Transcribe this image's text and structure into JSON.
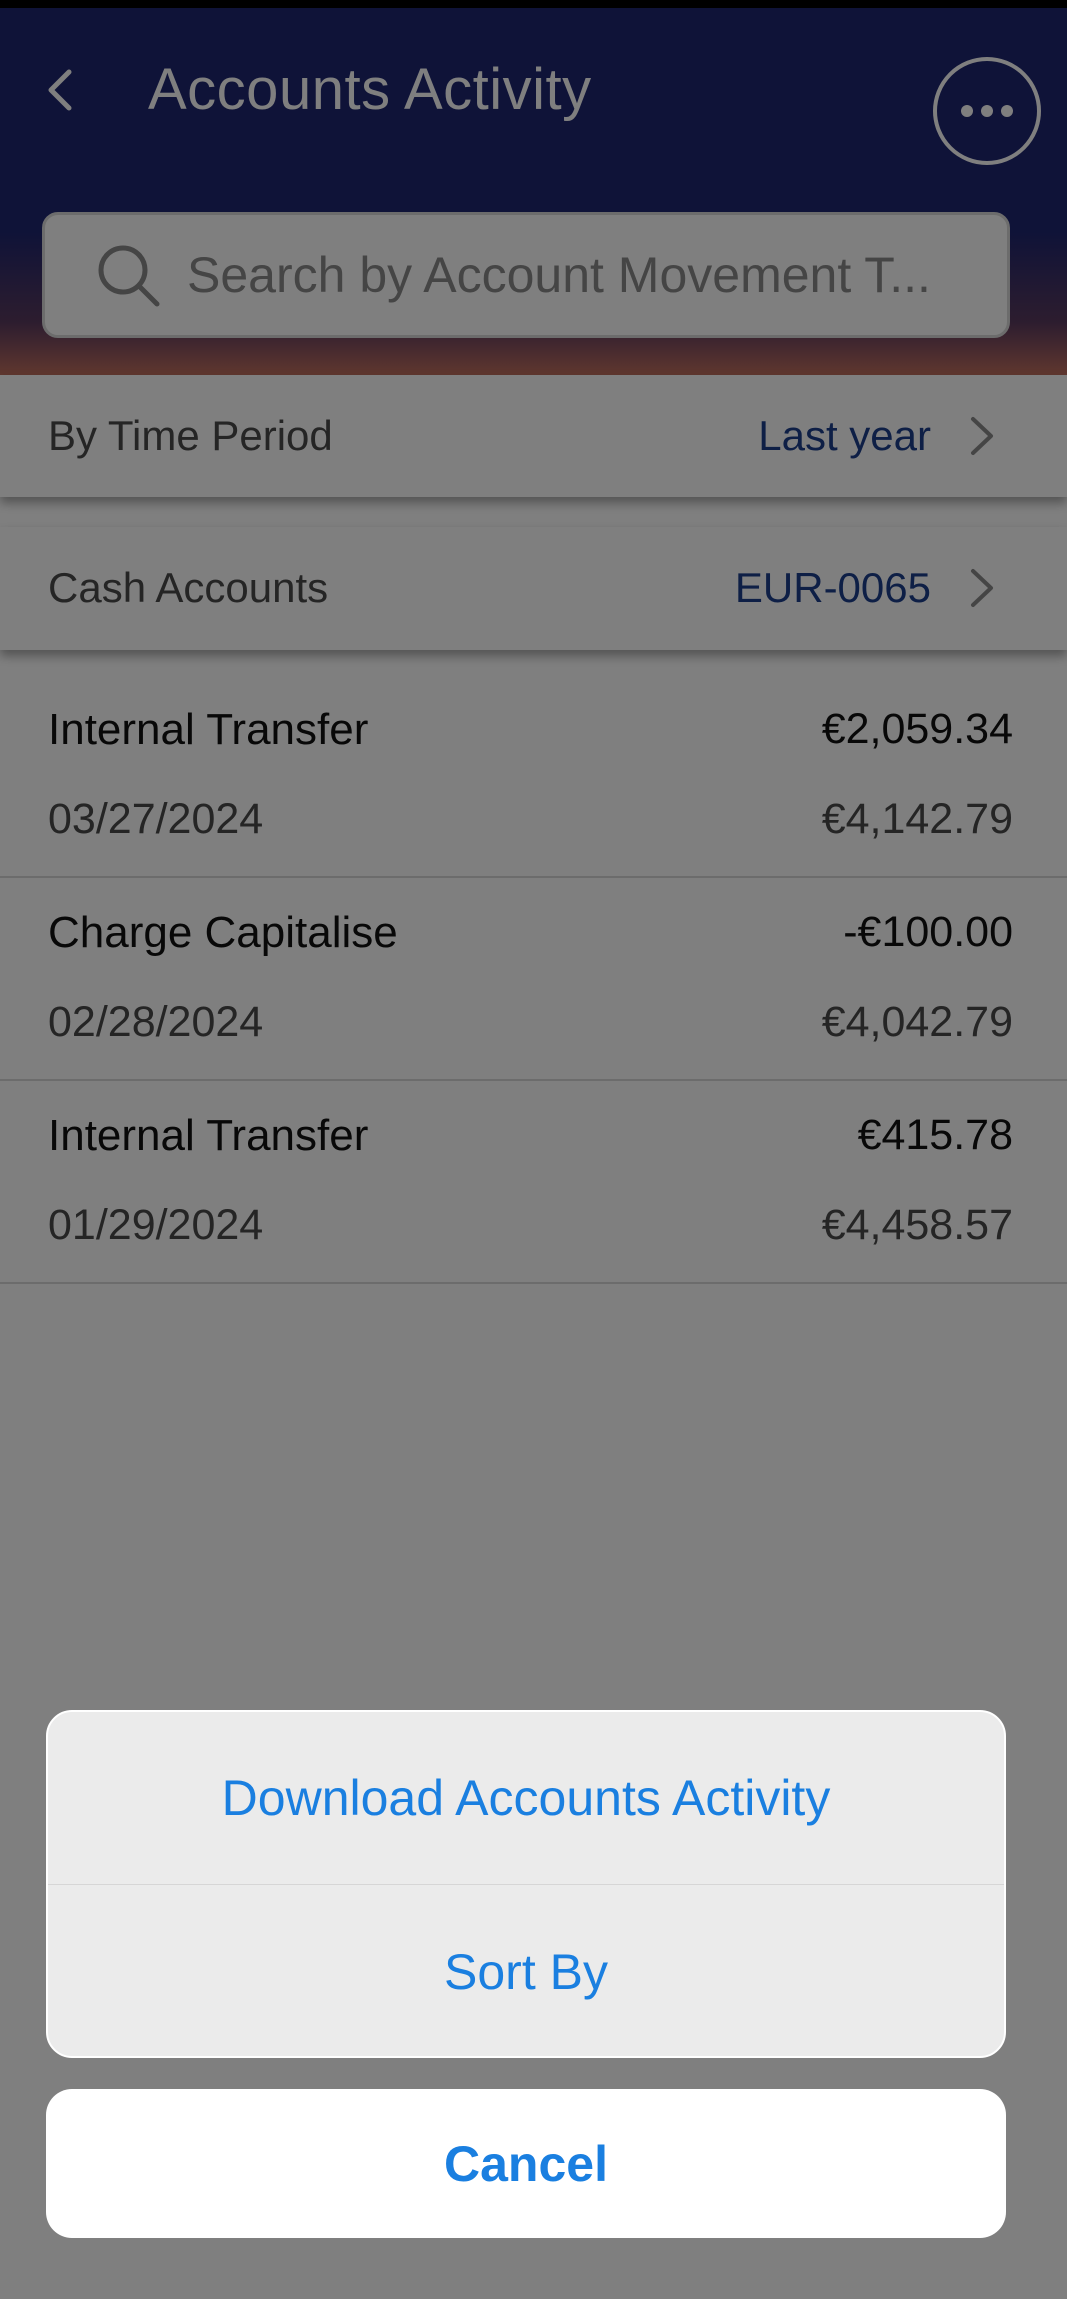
{
  "header": {
    "title": "Accounts Activity"
  },
  "search": {
    "placeholder": "Search by Account Movement T..."
  },
  "filters": [
    {
      "label": "By Time Period",
      "value": "Last year"
    },
    {
      "label": "Cash Accounts",
      "value": "EUR-0065"
    }
  ],
  "transactions": [
    {
      "title": "Internal Transfer",
      "date": "03/27/2024",
      "amount": "€2,059.34",
      "balance": "€4,142.79"
    },
    {
      "title": "Charge Capitalise",
      "date": "02/28/2024",
      "amount": "-€100.00",
      "balance": "€4,042.79"
    },
    {
      "title": "Internal Transfer",
      "date": "01/29/2024",
      "amount": "€415.78",
      "balance": "€4,458.57"
    }
  ],
  "action_sheet": {
    "options": [
      {
        "label": "Download Accounts Activity"
      },
      {
        "label": "Sort By"
      }
    ],
    "cancel_label": "Cancel"
  },
  "colors": {
    "header_bg": "#1f2670",
    "link_blue": "#1c3f8c",
    "ios_blue": "#1a7fe0"
  },
  "icons": {
    "back": "back-chevron-icon",
    "more": "more-horizontal-icon",
    "search": "search-icon",
    "row_chevron": "chevron-right-icon"
  }
}
